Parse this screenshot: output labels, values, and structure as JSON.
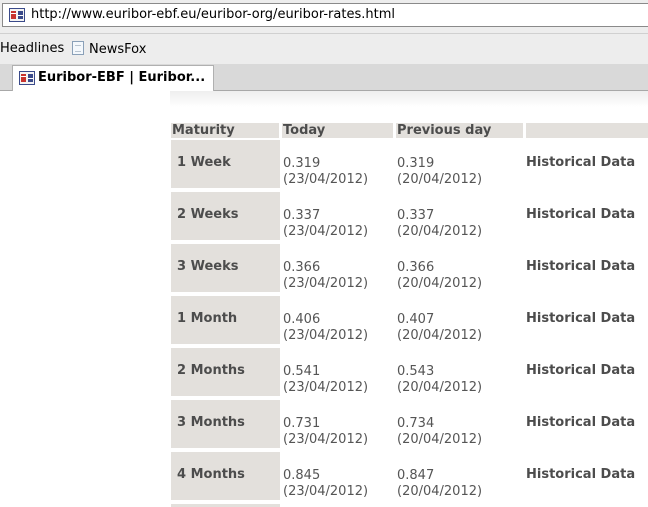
{
  "browser": {
    "url": "http://www.euribor-ebf.eu/euribor-org/euribor-rates.html",
    "bookmarks": [
      "Headlines",
      "NewsFox"
    ],
    "tab_title": "Euribor-EBF | Euribor...",
    "site_icon": "euribor-favicon-icon",
    "bookmark_icon": "document-icon"
  },
  "table": {
    "headers": {
      "maturity": "Maturity",
      "today": "Today",
      "previous": "Previous day"
    },
    "rows": [
      {
        "maturity": "1 Week",
        "today_value": "0.319",
        "today_date": "(23/04/2012)",
        "prev_value": "0.319",
        "prev_date": "(20/04/2012)",
        "link": "Historical Data"
      },
      {
        "maturity": "2 Weeks",
        "today_value": "0.337",
        "today_date": "(23/04/2012)",
        "prev_value": "0.337",
        "prev_date": "(20/04/2012)",
        "link": "Historical Data"
      },
      {
        "maturity": "3 Weeks",
        "today_value": "0.366",
        "today_date": "(23/04/2012)",
        "prev_value": "0.366",
        "prev_date": "(20/04/2012)",
        "link": "Historical Data"
      },
      {
        "maturity": "1 Month",
        "today_value": "0.406",
        "today_date": "(23/04/2012)",
        "prev_value": "0.407",
        "prev_date": "(20/04/2012)",
        "link": "Historical Data"
      },
      {
        "maturity": "2 Months",
        "today_value": "0.541",
        "today_date": "(23/04/2012)",
        "prev_value": "0.543",
        "prev_date": "(20/04/2012)",
        "link": "Historical Data"
      },
      {
        "maturity": "3 Months",
        "today_value": "0.731",
        "today_date": "(23/04/2012)",
        "prev_value": "0.734",
        "prev_date": "(20/04/2012)",
        "link": "Historical Data"
      },
      {
        "maturity": "4 Months",
        "today_value": "0.845",
        "today_date": "(23/04/2012)",
        "prev_value": "0.847",
        "prev_date": "(20/04/2012)",
        "link": "Historical Data"
      }
    ]
  },
  "colors": {
    "header_bg": "#e3e0dc",
    "label_text": "#4c4c4c",
    "value_text": "#555555"
  }
}
